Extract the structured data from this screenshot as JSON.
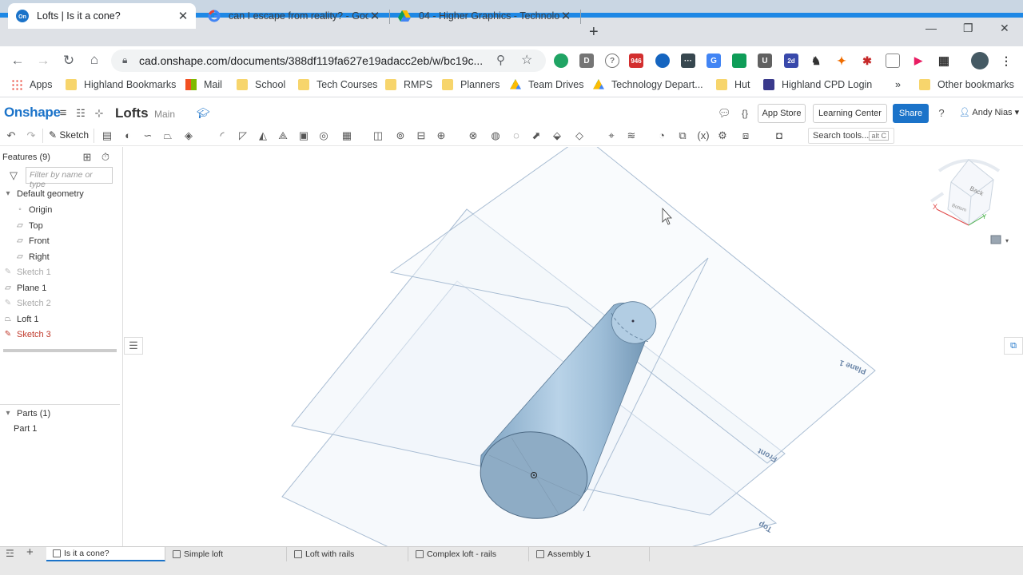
{
  "browser": {
    "tabs": [
      {
        "title": "Lofts | Is it a cone?",
        "favicon": "onshape-favicon"
      },
      {
        "title": "can I escape from reality? - Goog",
        "favicon": "google-favicon"
      },
      {
        "title": "04 - Higher Graphics - Technolog",
        "favicon": "drive-favicon"
      }
    ],
    "url": "cad.onshape.com/documents/388df119fa627e19adacc2eb/w/bc19c...",
    "ext_badge": "946",
    "ext_badge2": "2d",
    "ext_letter_d": "D",
    "ext_letter_u": "U"
  },
  "bookmarks": [
    {
      "label": "Apps",
      "icon": "apps-grid-icon"
    },
    {
      "label": "Highland Bookmarks",
      "icon": "folder-icon"
    },
    {
      "label": "Mail",
      "icon": "microsoft-icon"
    },
    {
      "label": "School",
      "icon": "folder-icon"
    },
    {
      "label": "Tech Courses",
      "icon": "folder-icon"
    },
    {
      "label": "RMPS",
      "icon": "folder-icon"
    },
    {
      "label": "Planners",
      "icon": "folder-icon"
    },
    {
      "label": "Team Drives",
      "icon": "drive-icon"
    },
    {
      "label": "Technology Depart...",
      "icon": "drive-icon"
    },
    {
      "label": "Hut",
      "icon": "folder-icon"
    },
    {
      "label": "Highland CPD  Login",
      "icon": "cpd-icon"
    },
    {
      "label": "»",
      "icon": ""
    },
    {
      "label": "Other bookmarks",
      "icon": "folder-icon"
    }
  ],
  "onshape": {
    "logo": "Onshape",
    "doc_name": "Lofts",
    "branch": "Main",
    "app_store": "App Store",
    "learning_center": "Learning Center",
    "share": "Share",
    "user": "Andy Nias",
    "sketch": "Sketch",
    "search_tools": "Search tools...",
    "search_shortcut": "alt C"
  },
  "features": {
    "header": "Features (9)",
    "filter_placeholder": "Filter by name or type",
    "default_geometry": "Default geometry",
    "items": [
      "Origin",
      "Top",
      "Front",
      "Right",
      "Sketch 1",
      "Plane 1",
      "Sketch 2",
      "Loft 1",
      "Sketch 3"
    ],
    "parts_header": "Parts (1)",
    "parts": [
      "Part 1"
    ]
  },
  "viewport": {
    "plane_labels": [
      "Plane 1",
      "Front",
      "Top"
    ],
    "viewcube_labels": [
      "Back",
      "Bottom"
    ],
    "axis_labels": [
      "X",
      "Y"
    ]
  },
  "bottom_tabs": [
    "Is it a cone?",
    "Simple loft",
    "Loft with rails",
    "Complex loft - rails",
    "Assembly 1"
  ]
}
